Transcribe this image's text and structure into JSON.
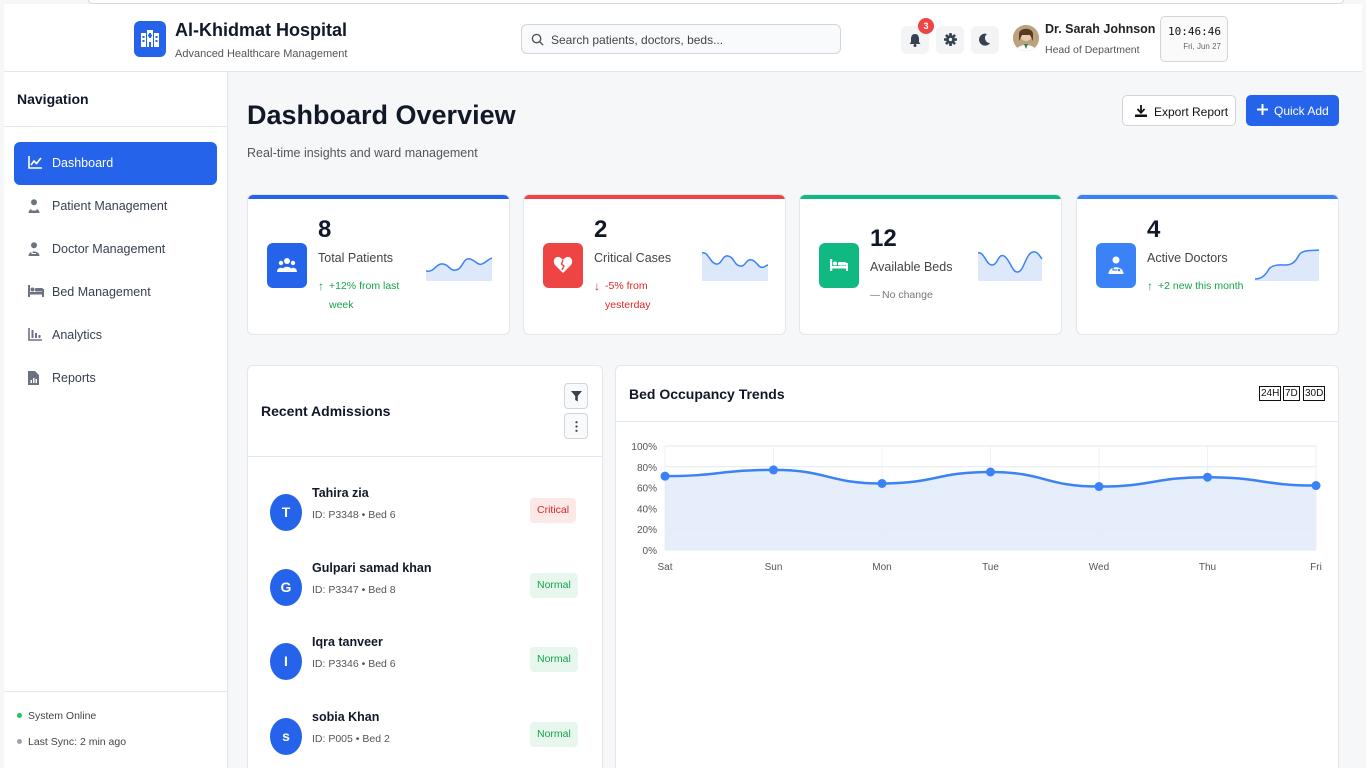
{
  "header": {
    "title": "Al-Khidmat Hospital",
    "subtitle": "Advanced Healthcare Management",
    "search_placeholder": "Search patients, doctors, beds...",
    "notification_count": "3",
    "user": {
      "name": "Dr. Sarah Johnson",
      "role": "Head of Department"
    },
    "clock": {
      "time": "10:46:46",
      "date": "Fri, Jun 27"
    }
  },
  "sidebar": {
    "title": "Navigation",
    "items": [
      {
        "label": "Dashboard",
        "icon": "chart-line-icon",
        "active": true
      },
      {
        "label": "Patient Management",
        "icon": "user-injured-icon"
      },
      {
        "label": "Doctor Management",
        "icon": "user-doctor-icon"
      },
      {
        "label": "Bed Management",
        "icon": "bed-icon"
      },
      {
        "label": "Analytics",
        "icon": "chart-bar-icon"
      },
      {
        "label": "Reports",
        "icon": "file-report-icon"
      }
    ],
    "status_online": "System Online",
    "last_sync": "Last Sync: 2 min ago"
  },
  "main": {
    "title": "Dashboard Overview",
    "subtitle": "Real-time insights and ward management",
    "export_label": "Export Report",
    "quick_add_label": "Quick Add"
  },
  "stats": [
    {
      "value": "8",
      "label": "Total Patients",
      "change": "+12% from last week",
      "arrow": "↑",
      "trend": "up",
      "color": "#2563eb"
    },
    {
      "value": "2",
      "label": "Critical Cases",
      "change": "-5% from yesterday",
      "arrow": "↓",
      "trend": "down",
      "color": "#ef4444"
    },
    {
      "value": "12",
      "label": "Available Beds",
      "change": "No change",
      "arrow": "—",
      "trend": "flat",
      "color": "#10b981"
    },
    {
      "value": "4",
      "label": "Active Doctors",
      "change": "+2 new this month",
      "arrow": "↑",
      "trend": "up",
      "color": "#3b82f6"
    }
  ],
  "admissions": {
    "title": "Recent Admissions",
    "items": [
      {
        "initial": "T",
        "name": "Tahira zia",
        "details": "ID: P3348 • Bed 6",
        "status": "Critical"
      },
      {
        "initial": "G",
        "name": "Gulpari samad khan",
        "details": "ID: P3347 • Bed 8",
        "status": "Normal"
      },
      {
        "initial": "I",
        "name": "Iqra tanveer",
        "details": "ID: P3346 • Bed 6",
        "status": "Normal"
      },
      {
        "initial": "s",
        "name": "sobia Khan",
        "details": "ID: P005 • Bed 2",
        "status": "Normal"
      }
    ]
  },
  "occupancy": {
    "title": "Bed Occupancy Trends",
    "ranges": [
      "24H",
      "7D",
      "30D"
    ]
  },
  "chart_data": {
    "type": "area",
    "title": "Bed Occupancy Trends",
    "categories": [
      "Sat",
      "Sun",
      "Mon",
      "Tue",
      "Wed",
      "Thu",
      "Fri"
    ],
    "series": [
      {
        "values": [
          71,
          77,
          64,
          75,
          61,
          70,
          62
        ],
        "color": "#3b82f6"
      }
    ],
    "ylim": [
      0,
      100
    ],
    "yticks": [
      "0%",
      "20%",
      "40%",
      "60%",
      "80%",
      "100%"
    ],
    "grid": true
  }
}
